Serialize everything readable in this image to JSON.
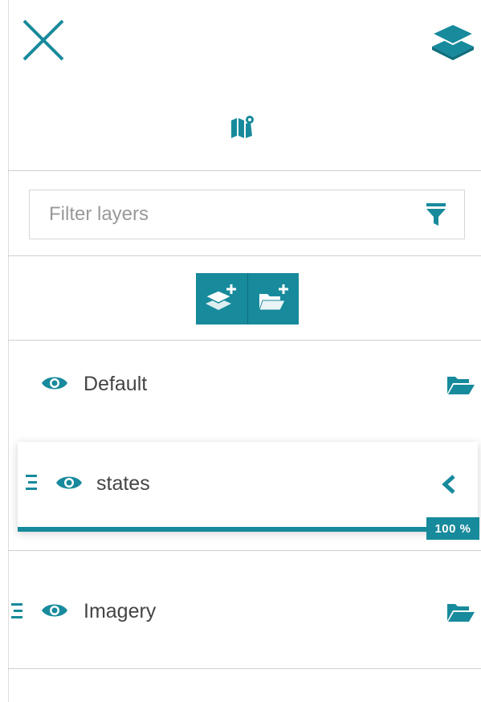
{
  "header": {
    "close_icon": "close-icon",
    "layers_icon": "layers-stack-icon",
    "map_icon": "map-pin-icon"
  },
  "filter": {
    "placeholder": "Filter layers",
    "value": "",
    "icon": "funnel-icon"
  },
  "toolbar": {
    "add_layer_icon": "add-layer-icon",
    "add_group_icon": "add-folder-icon"
  },
  "layers": [
    {
      "label": "Default",
      "visible": true,
      "kind": "group",
      "icon": "folder-open-icon"
    },
    {
      "label": "states",
      "visible": true,
      "kind": "layer",
      "expanded": true,
      "opacity_label": "100 %",
      "opacity": 1.0
    },
    {
      "label": "Imagery",
      "visible": true,
      "kind": "group",
      "icon": "folder-open-icon"
    }
  ],
  "colors": {
    "accent": "#178a9c",
    "divider": "#cfcfcf",
    "text": "#444444"
  }
}
